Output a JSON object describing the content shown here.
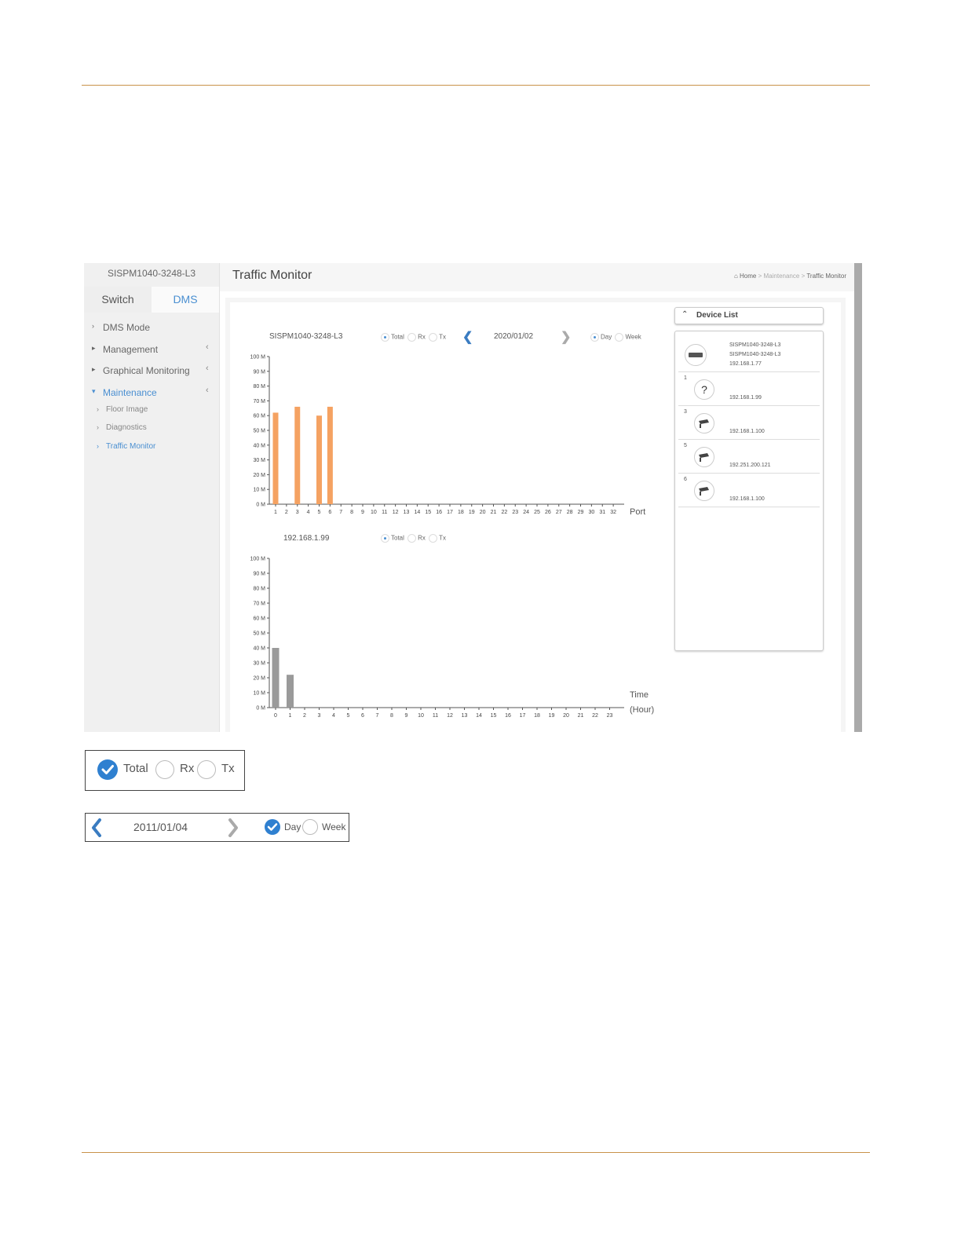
{
  "page": {
    "accent": "#c8924a"
  },
  "sidebar": {
    "device_name": "SISPM1040-3248-L3",
    "tabs": [
      {
        "label": "Switch"
      },
      {
        "label": "DMS"
      }
    ],
    "menu": [
      {
        "label": "DMS Mode"
      },
      {
        "label": "Management"
      },
      {
        "label": "Graphical Monitoring"
      },
      {
        "label": "Maintenance"
      }
    ],
    "submenu": [
      {
        "label": "Floor Image"
      },
      {
        "label": "Diagnostics"
      },
      {
        "label": "Traffic Monitor"
      }
    ]
  },
  "header": {
    "title": "Traffic Monitor",
    "breadcrumb": [
      "Home",
      "Maintenance",
      "Traffic Monitor"
    ]
  },
  "controls": {
    "radio_labels": [
      "Total",
      "Rx",
      "Tx"
    ],
    "period_labels": [
      "Day",
      "Week"
    ],
    "date": "2020/01/02",
    "selected_mode": "Total",
    "selected_period": "Day"
  },
  "device_list": {
    "title": "Device List",
    "devices": [
      {
        "port": "",
        "icon": "switch-icon",
        "lines": [
          "SISPM1040-3248-L3",
          "SISPM1040-3248-L3",
          "192.168.1.77"
        ]
      },
      {
        "port": "1",
        "icon": "unknown-device-icon",
        "lines": [
          "192.168.1.99"
        ]
      },
      {
        "port": "3",
        "icon": "camera-icon",
        "lines": [
          "192.168.1.100"
        ]
      },
      {
        "port": "5",
        "icon": "camera-icon",
        "lines": [
          "192.251.200.121"
        ]
      },
      {
        "port": "6",
        "icon": "camera-icon",
        "lines": [
          "192.168.1.100"
        ]
      }
    ]
  },
  "callouts": {
    "radio": {
      "labels": [
        "Total",
        "Rx",
        "Tx"
      ],
      "selected": "Total"
    },
    "date_nav": {
      "date": "2011/01/04",
      "labels": [
        "Day",
        "Week"
      ],
      "selected": "Day"
    }
  },
  "chart_data": [
    {
      "type": "bar",
      "title": "SISPM1040-3248-L3",
      "xlabel": "Port",
      "ylabel": "",
      "bar_color": "#f5a262",
      "categories": [
        "1",
        "2",
        "3",
        "4",
        "5",
        "6",
        "7",
        "8",
        "9",
        "10",
        "11",
        "12",
        "13",
        "14",
        "15",
        "16",
        "17",
        "18",
        "19",
        "20",
        "21",
        "22",
        "23",
        "24",
        "25",
        "26",
        "27",
        "28",
        "29",
        "30",
        "31",
        "32"
      ],
      "values": [
        62,
        0,
        66,
        0,
        60,
        66,
        0,
        0,
        0,
        0,
        0,
        0,
        0,
        0,
        0,
        0,
        0,
        0,
        0,
        0,
        0,
        0,
        0,
        0,
        0,
        0,
        0,
        0,
        0,
        0,
        0,
        0
      ],
      "yticks": [
        "0 M",
        "10 M",
        "20 M",
        "30 M",
        "40 M",
        "50 M",
        "60 M",
        "70 M",
        "80 M",
        "90 M",
        "100 M"
      ],
      "ylim": [
        0,
        100
      ]
    },
    {
      "type": "bar",
      "title": "192.168.1.99",
      "xlabel": "Time",
      "xlabel2": "(Hour)",
      "ylabel": "",
      "bar_color": "#9a9a9a",
      "categories": [
        "0",
        "1",
        "2",
        "3",
        "4",
        "5",
        "6",
        "7",
        "8",
        "9",
        "10",
        "11",
        "12",
        "13",
        "14",
        "15",
        "16",
        "17",
        "18",
        "19",
        "20",
        "21",
        "22",
        "23"
      ],
      "values": [
        40,
        22,
        0,
        0,
        0,
        0,
        0,
        0,
        0,
        0,
        0,
        0,
        0,
        0,
        0,
        0,
        0,
        0,
        0,
        0,
        0,
        0,
        0,
        0
      ],
      "yticks": [
        "0 M",
        "10 M",
        "20 M",
        "30 M",
        "40 M",
        "50 M",
        "60 M",
        "70 M",
        "80 M",
        "90 M",
        "100 M"
      ],
      "ylim": [
        0,
        100
      ]
    }
  ]
}
